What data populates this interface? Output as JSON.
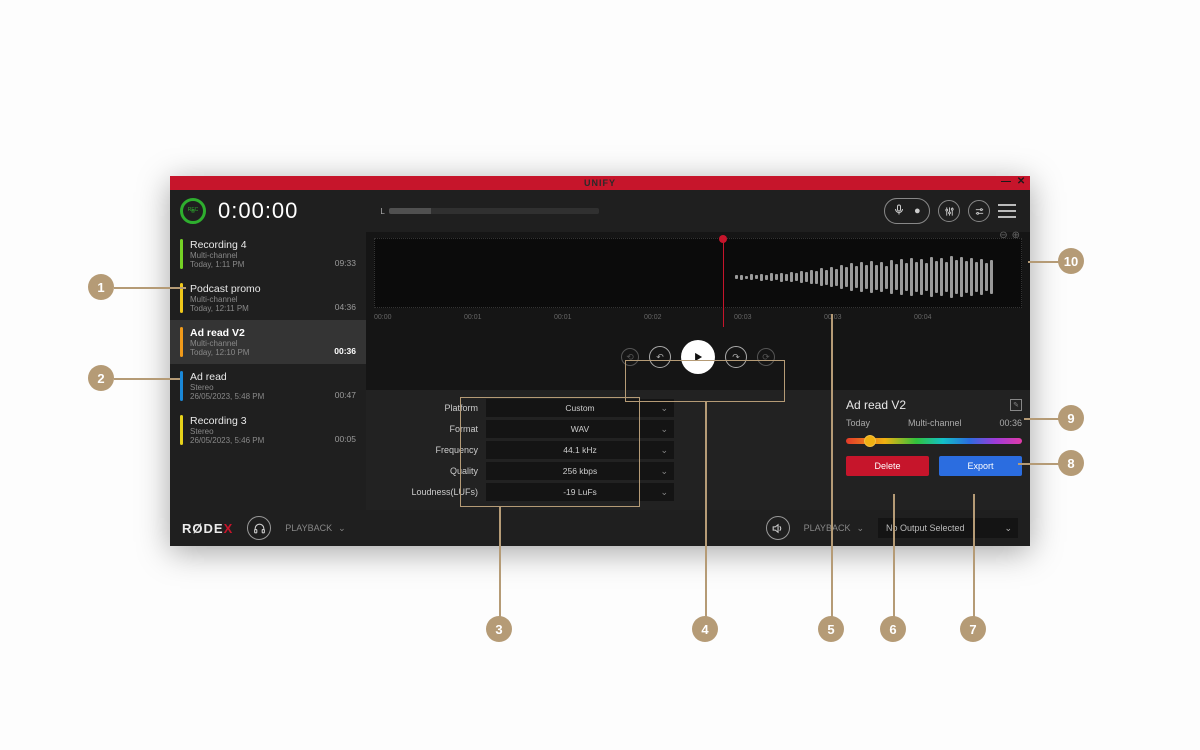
{
  "window": {
    "title": "UNIFY"
  },
  "header": {
    "rec_label": "REC",
    "timer": "0:00:00",
    "level_label": "L"
  },
  "recordings": [
    {
      "title": "Recording 4",
      "sub": "Multi-channel",
      "date": "Today, 1:11 PM",
      "dur": "09:33",
      "color": "#75d225"
    },
    {
      "title": "Podcast promo",
      "sub": "Multi-channel",
      "date": "Today, 12:11 PM",
      "dur": "04:36",
      "color": "#f0c81a"
    },
    {
      "title": "Ad read V2",
      "sub": "Multi-channel",
      "date": "Today, 12:10 PM",
      "dur": "00:36",
      "color": "#f09a1a",
      "selected": true
    },
    {
      "title": "Ad read",
      "sub": "Stereo",
      "date": "26/05/2023, 5:48 PM",
      "dur": "00:47",
      "color": "#1a88d8"
    },
    {
      "title": "Recording 3",
      "sub": "Stereo",
      "date": "26/05/2023, 5:46 PM",
      "dur": "00:05",
      "color": "#e6d21a"
    }
  ],
  "ticks": [
    "00:00",
    "00:01",
    "00:01",
    "00:02",
    "00:03",
    "00:03",
    "00:04"
  ],
  "settings": {
    "platform_label": "Platform",
    "platform_value": "Custom",
    "format_label": "Format",
    "format_value": "WAV",
    "freq_label": "Frequency",
    "freq_value": "44.1 kHz",
    "quality_label": "Quality",
    "quality_value": "256 kbps",
    "loud_label": "Loudness(LUFs)",
    "loud_value": "-19 LuFs"
  },
  "details": {
    "name": "Ad read V2",
    "date": "Today",
    "type": "Multi-channel",
    "dur": "00:36",
    "delete_label": "Delete",
    "export_label": "Export"
  },
  "footer": {
    "brand_main": "RØDE",
    "brand_x": "X",
    "playback_l": "PLAYBACK",
    "playback_r": "PLAYBACK",
    "output": "No Output Selected"
  },
  "callouts": {
    "n1": "1",
    "n2": "2",
    "n3": "3",
    "n4": "4",
    "n5": "5",
    "n6": "6",
    "n7": "7",
    "n8": "8",
    "n9": "9",
    "n10": "10"
  }
}
